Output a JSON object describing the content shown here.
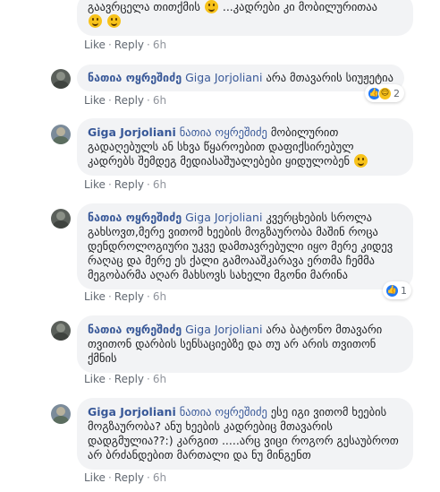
{
  "comments": [
    {
      "text": "გაავრცელა თითქმის",
      "text2": "...კადრები კი მობილურითაა",
      "time": "6h"
    },
    {
      "author": "ნათია ოყრეშიძე",
      "mention": "Giga Jorjoliani",
      "text": "არა მთავარის სიუჟეტია",
      "time": "6h",
      "reaction_count": "2"
    },
    {
      "author": "Giga Jorjoliani",
      "mention": "ნათია ოყრეშიძე",
      "text": "მობილურით გადაღებულს ან სხვა წყაროებით დაფიქსირებულ კადრებს შემდეგ მედიასაშუალებები ყიდულობენ",
      "time": "6h"
    },
    {
      "author": "ნათია ოყრეშიძე",
      "mention": "Giga Jorjoliani",
      "text": "კვერცხების სროლა გახსოვთ,მერე ვითომ ხეების მოგზაურობა მაშინ როცა დენდროლოგიური უკვე დამთავრებული იყო მერე კიდევ რაღაც და მერე ეს ქალი გამოააშკარავა ერთმა ჩემმა მეგობარმა აღარ მახსოვს სახელი მგონი მარინა",
      "time": "6h",
      "reaction_count": "1"
    },
    {
      "author": "ნათია ოყრეშიძე",
      "mention": "Giga Jorjoliani",
      "text": "არა ბატონო მთავარი თვითონ დარბის სენსაციებზე და თუ არ არის თვითონ ქმნის",
      "time": "6h"
    },
    {
      "author": "Giga Jorjoliani",
      "mention": "ნათია ოყრეშიძე",
      "text": "ესე იგი ვითომ ხეების მოგზაურობა? ანუ ხეების კადრებიც მთავარის დადგმულია??:) კარგით .....არც ვიცი როგორ გესაუბროთ არ ბრძანდებით მართალი და ნუ მინგენთ",
      "time": "6h"
    }
  ],
  "labels": {
    "like": "Like",
    "reply": "Reply",
    "dot": "·"
  },
  "icons": {
    "avatar": "profile-photo",
    "emoji": "smiley",
    "like": "thumbs-up",
    "haha": "laughing-face"
  },
  "colors": {
    "link": "#385898",
    "bubble": "#f2f3f5",
    "like_blue": "#2078f4"
  }
}
